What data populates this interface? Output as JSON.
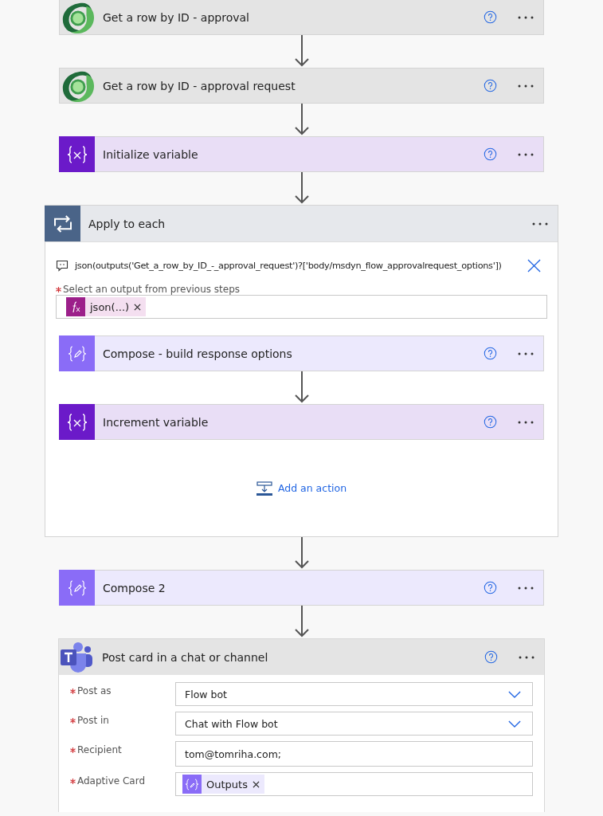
{
  "steps": [
    {
      "kind": "dataverse",
      "title": "Get a row by ID - approval"
    },
    {
      "kind": "dataverse",
      "title": "Get a row by ID - approval request"
    },
    {
      "kind": "variable",
      "title": "Initialize variable"
    },
    {
      "kind": "loop",
      "title": "Apply to each",
      "expression": "json(outputs('Get_a_row_by_ID_-_approval_request')?['body/msdyn_flow_approvalrequest_options'])",
      "field": {
        "label": "Select an output from previous steps",
        "required": true,
        "token": {
          "kind": "expression",
          "label": "json(...)"
        }
      },
      "children": [
        {
          "kind": "compose",
          "title": "Compose - build response options"
        },
        {
          "kind": "variable",
          "title": "Increment variable"
        }
      ],
      "add_action": "Add an action"
    },
    {
      "kind": "compose",
      "title": "Compose 2"
    },
    {
      "kind": "teams",
      "title": "Post card in a chat or channel",
      "fields": [
        {
          "label": "Post as",
          "required": true,
          "kind": "dropdown",
          "value": "Flow bot"
        },
        {
          "label": "Post in",
          "required": true,
          "kind": "dropdown",
          "value": "Chat with Flow bot"
        },
        {
          "label": "Recipient",
          "required": true,
          "kind": "text",
          "value": "tom@tomriha.com;"
        },
        {
          "label": "Adaptive Card",
          "required": true,
          "kind": "token",
          "token": {
            "kind": "compose",
            "label": "Outputs"
          }
        }
      ]
    }
  ]
}
